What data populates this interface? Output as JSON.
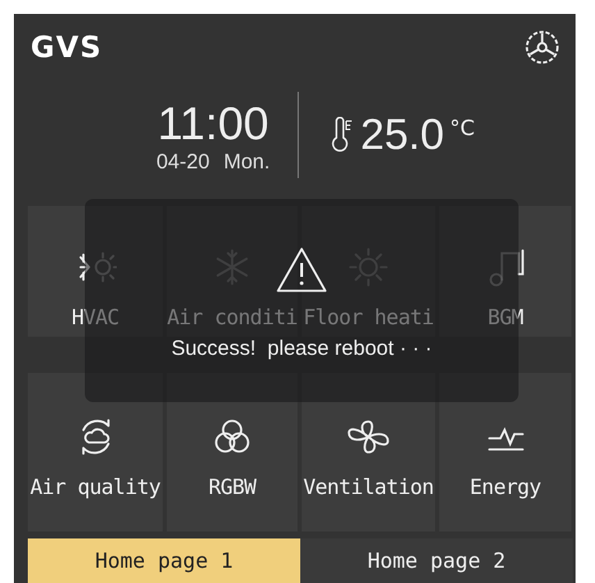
{
  "header": {
    "logo": "GVS"
  },
  "clock": {
    "time": "11:00",
    "date": "04-20",
    "weekday": "Mon."
  },
  "temperature": {
    "value": "25.0",
    "unit": "°C"
  },
  "tiles": [
    {
      "kind": "hvac",
      "label": "HVAC"
    },
    {
      "kind": "snowflake",
      "label": "Air conditi"
    },
    {
      "kind": "sun",
      "label": "Floor heati"
    },
    {
      "kind": "music",
      "label": "BGM"
    },
    {
      "kind": "air",
      "label": "Air quality"
    },
    {
      "kind": "rgbw",
      "label": "RGBW"
    },
    {
      "kind": "fan",
      "label": "Ventilation"
    },
    {
      "kind": "energy",
      "label": "Energy"
    }
  ],
  "dialog": {
    "message": "Success!  please reboot · · ·"
  },
  "tabs": [
    {
      "label": "Home page 1",
      "selected": true
    },
    {
      "label": "Home page 2",
      "selected": false
    }
  ]
}
